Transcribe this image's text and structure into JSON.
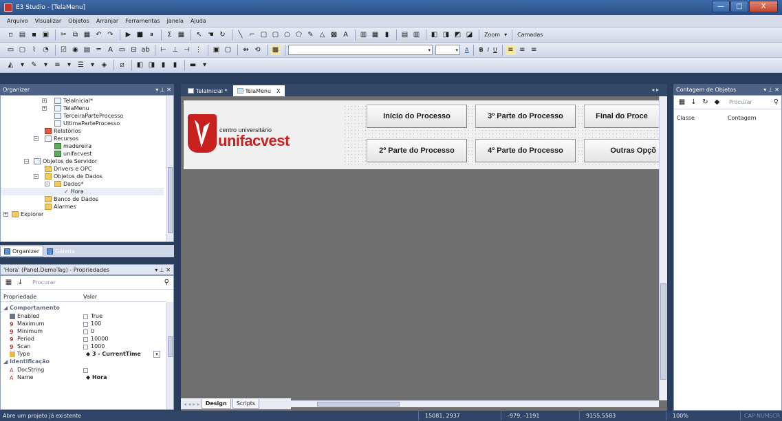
{
  "window": {
    "title": "E3 Studio - [TelaMenu]",
    "minimize_symbol": "—",
    "maximize_symbol": "□",
    "close_symbol": "X"
  },
  "menu": [
    "Arquivo",
    "Visualizar",
    "Objetos",
    "Arranjar",
    "Ferramentas",
    "Janela",
    "Ajuda"
  ],
  "toolbar": {
    "zoom_label": "Zoom",
    "camadas_label": "Camadas",
    "bold": "B",
    "italic": "I",
    "underline": "U",
    "font_color_letter": "A"
  },
  "organizer": {
    "title": "Organizer",
    "tree": {
      "telainicial": "TelaInicial*",
      "telamenu": "TelaMenu",
      "terceira": "TerceiraParteProcesso",
      "ultima": "UltimaParteProcesso",
      "relatorios": "Relatórios",
      "recursos": "Recursos",
      "madereira": "madereira",
      "unifacvest": "unifacvest",
      "objetos_servidor": "Objetos de Servidor",
      "drivers": "Drivers e OPC",
      "objetos_dados": "Objetos de Dados",
      "dados": "Dados*",
      "hora": "Hora",
      "banco": "Banco de Dados",
      "alarmes": "Alarmes",
      "explorer": "Explorer"
    },
    "tabs": [
      "Organizer",
      "Galeria"
    ]
  },
  "properties": {
    "title": "'Hora' (Panel.DemoTag) - Propriedades",
    "search_placeholder": "Procurar",
    "col_prop": "Propriedade",
    "col_value": "Valor",
    "categories": [
      "Comportamento",
      "Identificação"
    ],
    "rows": [
      {
        "name": "Enabled",
        "value": "True"
      },
      {
        "name": "Maximum",
        "value": "100"
      },
      {
        "name": "Minimum",
        "value": "0"
      },
      {
        "name": "Period",
        "value": "10000"
      },
      {
        "name": "Scan",
        "value": "1000"
      },
      {
        "name": "Type",
        "value": "3 - CurrentTime"
      },
      {
        "name": "DocString",
        "value": ""
      },
      {
        "name": "Name",
        "value": "Hora"
      }
    ]
  },
  "document": {
    "tabs": [
      "TelaInicial *",
      "TelaMenu"
    ],
    "close_symbol": "X",
    "logo_line1": "centro universitário",
    "logo_line2": "unifacvest",
    "buttons": [
      "Início do Processo",
      "3º Parte do Processo",
      "Final do Proce",
      "2º Parte do Processo",
      "4º Parte do Processo",
      "Outras Opçõ"
    ],
    "bottom_tabs": [
      "Design",
      "Scripts"
    ]
  },
  "contagem": {
    "title": "Contagem de Objetos",
    "search_placeholder": "Procurar",
    "col_classe": "Classe",
    "col_contagem": "Contagem"
  },
  "status": {
    "message": "Abre um projeto já existente",
    "coords1": "15081, 2937",
    "coords2": "-979, -1191",
    "coords3": "9155,5583",
    "zoom": "100%",
    "caps": "CAP",
    "num": "NUM",
    "scr": "SCR"
  }
}
